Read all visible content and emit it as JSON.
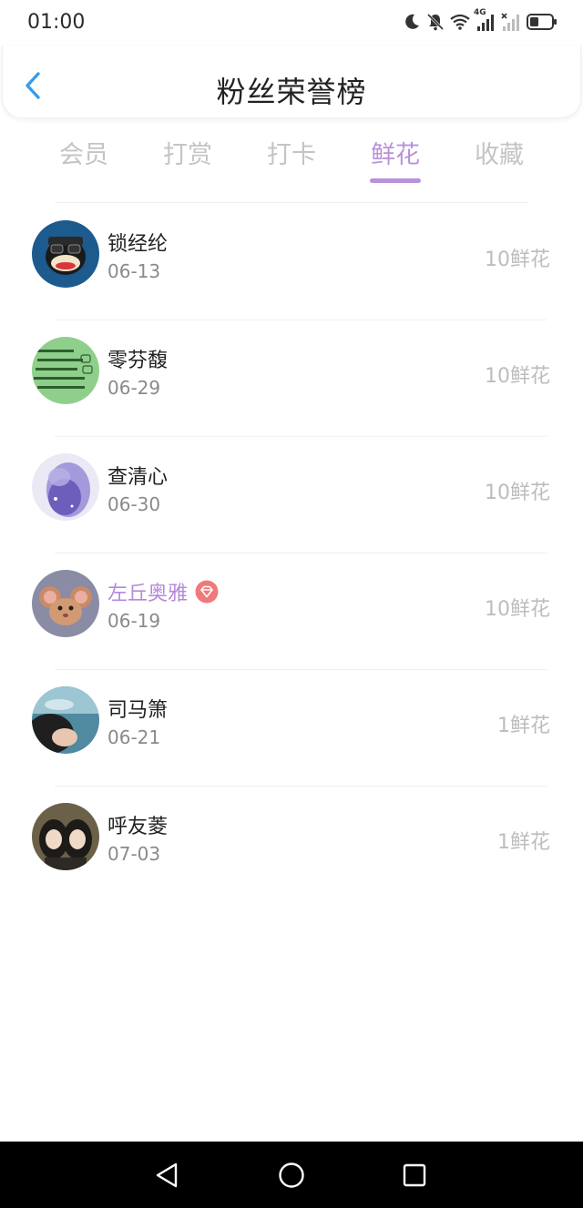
{
  "status_bar": {
    "time": "01:00",
    "network": "4G",
    "icons": [
      "moon-icon",
      "bell-off-icon",
      "wifi-icon",
      "signal-icon",
      "signal-no-sim-icon",
      "battery-icon"
    ]
  },
  "header": {
    "title": "粉丝荣誉榜",
    "back_icon": "chevron-left-icon",
    "accent_color": "#3a9be8"
  },
  "tabs": {
    "items": [
      {
        "label": "会员",
        "active": false
      },
      {
        "label": "打赏",
        "active": false
      },
      {
        "label": "打卡",
        "active": false
      },
      {
        "label": "鲜花",
        "active": true
      },
      {
        "label": "收藏",
        "active": false
      }
    ],
    "active_color": "#b991dc",
    "inactive_color": "#c4c4c4"
  },
  "fans": [
    {
      "name": "锁经纶",
      "date": "06-13",
      "count": "10鲜花",
      "vip": false,
      "avatar": "monkey-cartoon-avatar"
    },
    {
      "name": "零芬馥",
      "date": "06-29",
      "count": "10鲜花",
      "vip": false,
      "avatar": "green-text-avatar"
    },
    {
      "name": "查清心",
      "date": "06-30",
      "count": "10鲜花",
      "vip": false,
      "avatar": "purple-blur-avatar"
    },
    {
      "name": "左丘奥雅",
      "date": "06-19",
      "count": "10鲜花",
      "vip": true,
      "avatar": "cartoon-mouse-avatar"
    },
    {
      "name": "司马箫",
      "date": "06-21",
      "count": "1鲜花",
      "vip": false,
      "avatar": "person-photo-avatar"
    },
    {
      "name": "呼友菱",
      "date": "07-03",
      "count": "1鲜花",
      "vip": false,
      "avatar": "two-girls-avatar"
    }
  ],
  "vip_badge": {
    "icon": "diamond-badge-icon",
    "color": "#f07a7a"
  },
  "nav_bar": {
    "back_icon": "triangle-back-icon",
    "home_icon": "circle-home-icon",
    "recents_icon": "square-recents-icon"
  }
}
